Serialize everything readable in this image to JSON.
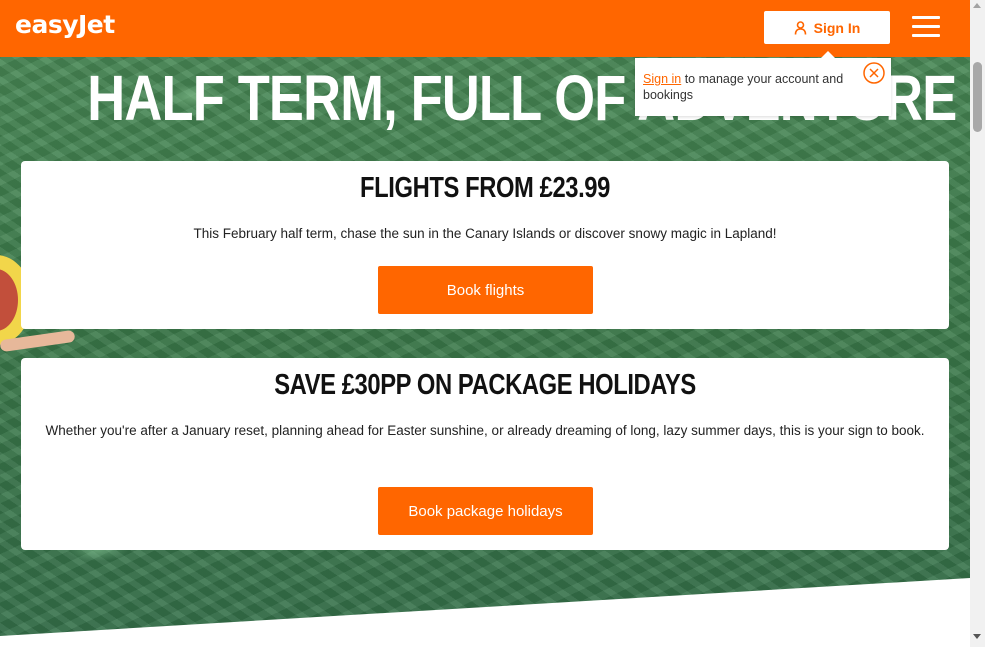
{
  "brand": {
    "logo_text": "easyJet",
    "accent_color": "#ff6600"
  },
  "header": {
    "signin_label": "Sign In",
    "signin_icon": "user-icon",
    "menu_icon": "hamburger-menu-icon"
  },
  "tooltip": {
    "link_text": "Sign in",
    "text": " to manage your account and bookings",
    "close_icon": "close-circle-icon"
  },
  "hero": {
    "title": "HALF TERM, FULL OF ADVENTURE"
  },
  "cards": [
    {
      "title": "FLIGHTS FROM £23.99",
      "text": "This February half term, chase the sun in the Canary Islands or discover snowy magic in Lapland!",
      "button": "Book flights"
    },
    {
      "title": "SAVE £30PP ON PACKAGE HOLIDAYS",
      "text": "Whether you're after a January reset, planning ahead for Easter sunshine, or already dreaming of long, lazy summer days, this is your sign to book.",
      "button": "Book package holidays"
    }
  ]
}
